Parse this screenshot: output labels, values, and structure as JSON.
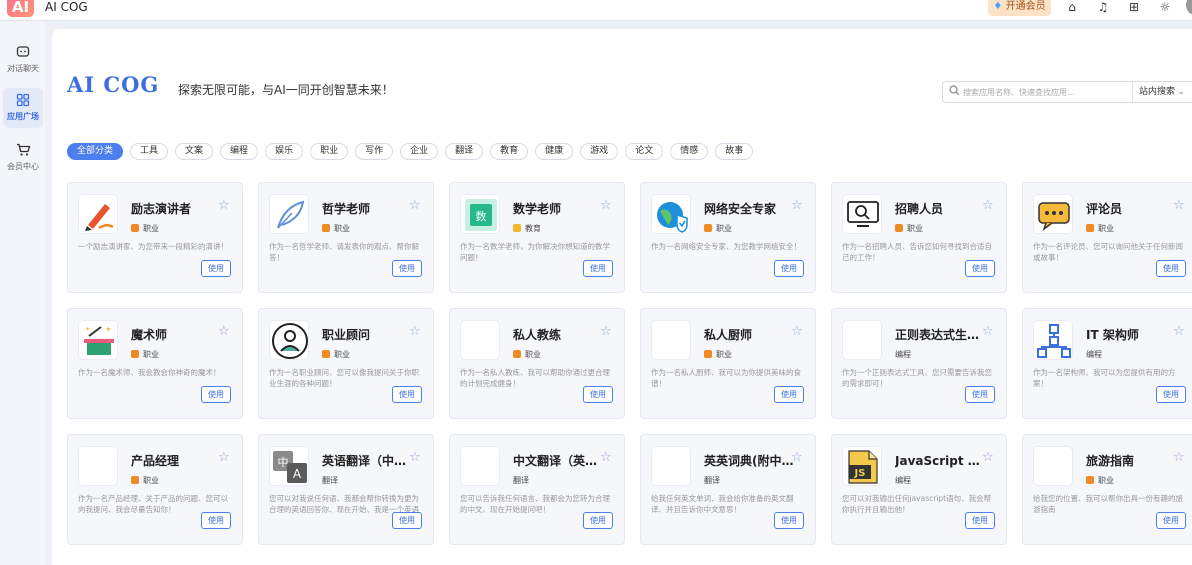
{
  "app": {
    "logo_text": "AI",
    "title": "AI COG"
  },
  "topbar": {
    "vip_label": "开通会员",
    "icons": [
      "store-icon",
      "bell-icon",
      "gift-icon",
      "sun-icon"
    ]
  },
  "sidebar": {
    "items": [
      {
        "label": "对话聊天",
        "icon": "chat-icon",
        "active": false
      },
      {
        "label": "应用广场",
        "icon": "grid-icon",
        "active": true
      },
      {
        "label": "会员中心",
        "icon": "cart-icon",
        "active": false
      }
    ]
  },
  "header": {
    "brand": "AI COG",
    "slogan": "探索无限可能，与AI一同开创智慧未来！"
  },
  "search": {
    "placeholder": "搜索应用名称、快速查找应用...",
    "scope": "站内搜索"
  },
  "categories": [
    "全部分类",
    "工具",
    "文案",
    "编程",
    "娱乐",
    "职业",
    "写作",
    "企业",
    "翻译",
    "教育",
    "健康",
    "游戏",
    "论文",
    "情感",
    "故事"
  ],
  "active_category": "全部分类",
  "cards": [
    {
      "title": "励志演讲者",
      "tag": "职业",
      "tag_color": "#f08a24",
      "desc": "一个励志演讲家、为您带来一段精彩的演讲！",
      "use": "使用",
      "icon": "speaker-brush-icon"
    },
    {
      "title": "哲学老师",
      "tag": "职业",
      "tag_color": "#f08a24",
      "desc": "作为一名哲学老师、请发表你的观点、帮你解答！",
      "use": "使用",
      "icon": "feather-icon"
    },
    {
      "title": "数学老师",
      "tag": "教育",
      "tag_color": "#f2b632",
      "desc": "作为一名数学老师，为你解决你想知道的数学问题！",
      "use": "使用",
      "icon": "math-book-icon"
    },
    {
      "title": "网络安全专家",
      "tag": "职业",
      "tag_color": "#f08a24",
      "desc": "作为一名网络安全专家、为您教学网络安全！",
      "use": "使用",
      "icon": "globe-shield-icon"
    },
    {
      "title": "招聘人员",
      "tag": "职业",
      "tag_color": "#f08a24",
      "desc": "作为一名招聘人员、告诉您如何寻找到合适自己的工作！",
      "use": "使用",
      "icon": "recruiter-icon"
    },
    {
      "title": "评论员",
      "tag": "职业",
      "tag_color": "#f08a24",
      "desc": "作为一名评论员、您可以询问他关于任何新闻或故事！",
      "use": "使用",
      "icon": "comment-bubble-icon"
    },
    {
      "title": "魔术师",
      "tag": "职业",
      "tag_color": "#f08a24",
      "desc": "作为一名魔术师、我会教会你神奇的魔术！",
      "use": "使用",
      "icon": "magic-hat-icon"
    },
    {
      "title": "职业顾问",
      "tag": "职业",
      "tag_color": "#f08a24",
      "desc": "作为一名职业顾问、您可以像我提问关于你职业生涯的各种问题！",
      "use": "使用",
      "icon": "advisor-icon"
    },
    {
      "title": "私人教练",
      "tag": "职业",
      "tag_color": "#f08a24",
      "desc": "作为一名私人教练、我可以帮助你通过更合理的计划完成健身！",
      "use": "使用",
      "icon": "blank-icon"
    },
    {
      "title": "私人厨师",
      "tag": "职业",
      "tag_color": "#f08a24",
      "desc": "作为一名私人厨师、我可以为你提供美味的食谱！",
      "use": "使用",
      "icon": "blank-icon"
    },
    {
      "title": "正则表达式生成器",
      "tag": "编程",
      "tag_color": "",
      "desc": "作为一个正则表达式工具、您只需要告诉我您的需求即可！",
      "use": "使用",
      "icon": "blank-icon"
    },
    {
      "title": "IT 架构师",
      "tag": "编程",
      "tag_color": "",
      "desc": "作为一名架构师、我可以为您提供有用的方案！",
      "use": "使用",
      "icon": "network-tree-icon"
    },
    {
      "title": "产品经理",
      "tag": "职业",
      "tag_color": "#f08a24",
      "desc": "作为一名产品经理、关于产品的问题、您可以向我提问、我会尽量告知你！",
      "use": "使用",
      "icon": "blank-icon"
    },
    {
      "title": "英语翻译（中英互译）",
      "tag": "翻译",
      "tag_color": "",
      "desc": "您可以对我说任何语、我都会帮你转换为更为合理的英语回答你、现在开始、我是一个英语翻译！",
      "use": "使用",
      "icon": "translate-icon"
    },
    {
      "title": "中文翻译（英译中）",
      "tag": "翻译",
      "tag_color": "",
      "desc": "您可以告诉我任何语言、我都会为您转为合理的中文、现在开始提问吧！",
      "use": "使用",
      "icon": "blank-icon"
    },
    {
      "title": "英英词典(附中文解释)",
      "tag": "翻译",
      "tag_color": "",
      "desc": "给我任何英文单词、我会给你准备的英文翻译、并且告诉你中文意思！",
      "use": "使用",
      "icon": "blank-icon"
    },
    {
      "title": "JavaScript 控制台",
      "tag": "编程",
      "tag_color": "",
      "desc": "您可以对我输出任何javascript语句、我会帮你执行并且输出他！",
      "use": "使用",
      "icon": "js-file-icon"
    },
    {
      "title": "旅游指南",
      "tag": "职业",
      "tag_color": "#f08a24",
      "desc": "给我您的位置、我可以帮你出具一份有趣的旅游指南",
      "use": "使用",
      "icon": "blank-icon"
    }
  ]
}
